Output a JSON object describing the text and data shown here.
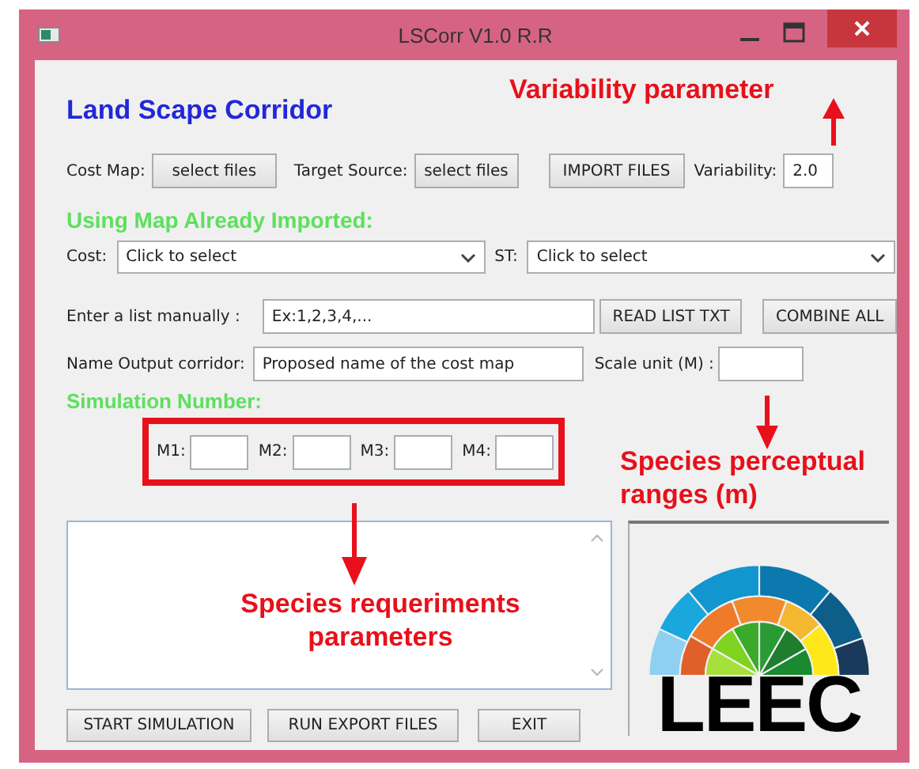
{
  "window": {
    "title": "LSCorr V1.0 R.R"
  },
  "heading": "Land Scape Corridor",
  "file_row": {
    "cost_map_label": "Cost Map:",
    "cost_map_button": "select files",
    "target_label": "Target Source:",
    "target_button": "select files",
    "import_button": "IMPORT FILES",
    "variability_label": "Variability:",
    "variability_value": "2.0"
  },
  "imported_heading": "Using Map Already Imported:",
  "selectors": [
    {
      "label": "Cost:",
      "value": "Click to select"
    },
    {
      "label": "ST:",
      "value": "Click to select"
    }
  ],
  "list_row": {
    "label": "Enter a list manually :",
    "value": "Ex:1,2,3,4,...",
    "read_button": "READ LIST TXT",
    "combine_button": "COMBINE ALL"
  },
  "output_row": {
    "label": "Name Output corridor:",
    "value": "Proposed name of the cost map",
    "scale_label": "Scale unit (M) :"
  },
  "simulation_heading": "Simulation Number:",
  "m_fields": [
    {
      "label": "M1:"
    },
    {
      "label": "M2:"
    },
    {
      "label": "M3:"
    },
    {
      "label": "M4:"
    }
  ],
  "buttons": [
    "START SIMULATION",
    "RUN  EXPORT FILES",
    "EXIT"
  ],
  "logo": {
    "text": "LEEC"
  },
  "annotations": {
    "variability": "Variability parameter",
    "perceptual": "Species perceptual ranges (m)",
    "requirements": "Species requeriments parameters"
  }
}
